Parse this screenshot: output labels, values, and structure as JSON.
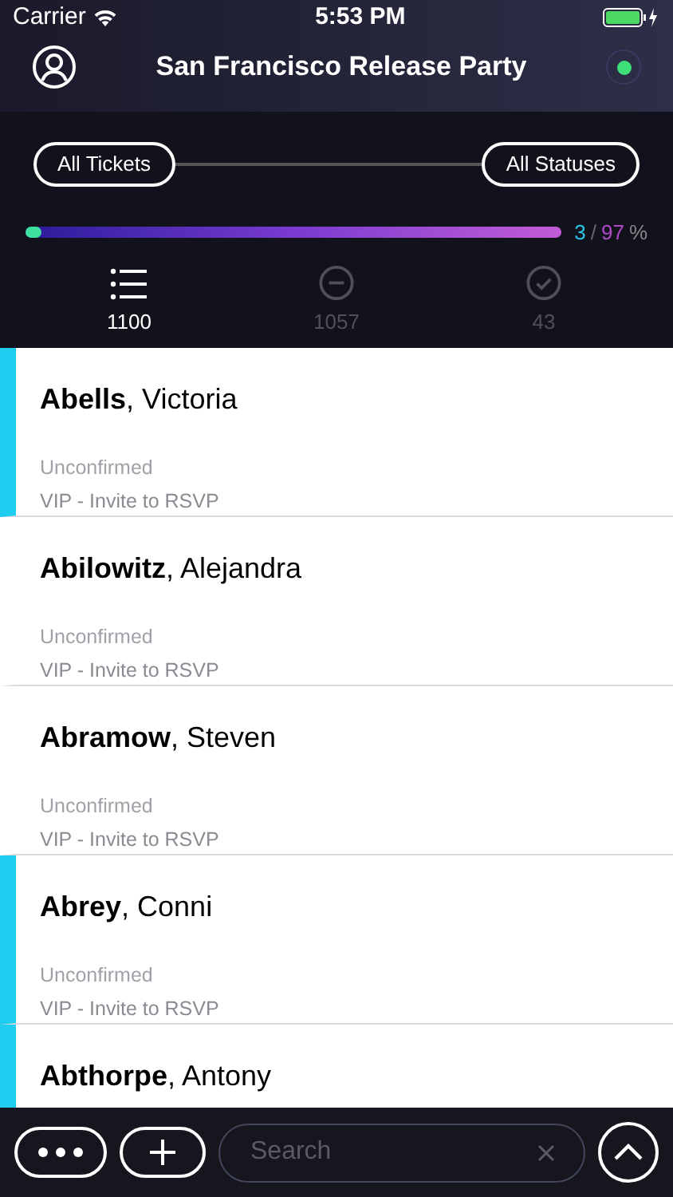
{
  "status_bar": {
    "carrier": "Carrier",
    "time": "5:53 PM"
  },
  "header": {
    "title": "San Francisco Release Party",
    "online": true
  },
  "filters": {
    "tickets": "All Tickets",
    "statuses": "All Statuses"
  },
  "progress": {
    "level": 0.03,
    "checked": "3",
    "separator": "/",
    "remaining": "97",
    "unit": "%"
  },
  "tabs": [
    {
      "kind": "all",
      "count": "1100",
      "selected": true
    },
    {
      "kind": "unchecked",
      "count": "1057",
      "selected": false
    },
    {
      "kind": "checked",
      "count": "43",
      "selected": false
    }
  ],
  "guests": [
    {
      "last": "Abells",
      "first": ", Victoria",
      "status": "Unconfirmed",
      "ticket": "VIP - Invite to RSVP",
      "flagged": true
    },
    {
      "last": "Abilowitz",
      "first": ", Alejandra",
      "status": "Unconfirmed",
      "ticket": "VIP - Invite to RSVP",
      "flagged": false
    },
    {
      "last": "Abramow",
      "first": ", Steven",
      "status": "Unconfirmed",
      "ticket": "VIP - Invite to RSVP",
      "flagged": false
    },
    {
      "last": "Abrey",
      "first": ", Conni",
      "status": "Unconfirmed",
      "ticket": "VIP - Invite to RSVP",
      "flagged": true
    },
    {
      "last": "Abthorpe",
      "first": ", Antony",
      "flagged": true
    }
  ],
  "search": {
    "placeholder": "Search"
  }
}
